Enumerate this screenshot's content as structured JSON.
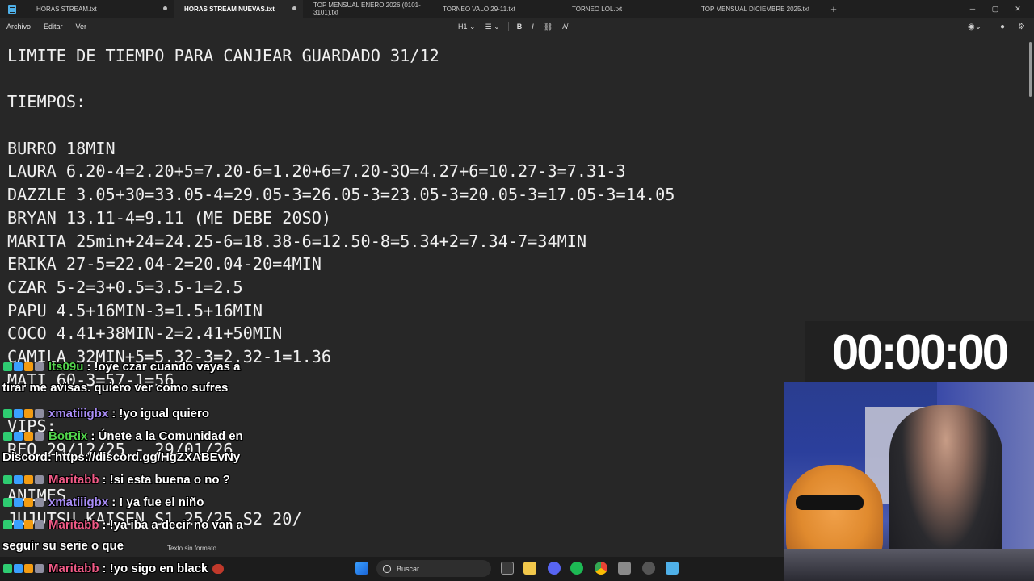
{
  "tabs": [
    {
      "label": "HORAS STREAM.txt",
      "active": false,
      "unsaved": true
    },
    {
      "label": "HORAS STREAM NUEVAS.txt",
      "active": true,
      "unsaved": true
    },
    {
      "label": "TOP MENSUAL ENERO 2026 (0101-3101).txt",
      "active": false,
      "unsaved": false
    },
    {
      "label": "TORNEO VALO 29-11.txt",
      "active": false,
      "unsaved": false
    },
    {
      "label": "TORNEO LOL.txt",
      "active": false,
      "unsaved": false
    },
    {
      "label": "TOP MENSUAL DICIEMBRE 2025.txt",
      "active": false,
      "unsaved": false
    }
  ],
  "tab_add": "+",
  "window_controls": {
    "minimize": "─",
    "maximize": "▢",
    "close": "✕"
  },
  "menu": {
    "file": "Archivo",
    "edit": "Editar",
    "view": "Ver"
  },
  "toolbar": {
    "heading": "H1",
    "bold": "B",
    "italic": "I"
  },
  "editor_lines": [
    "LIMITE DE TIEMPO PARA CANJEAR GUARDADO 31/12",
    "",
    "TIEMPOS:",
    "",
    "BURRO 18MIN",
    "LAURA 6.20-4=2.20+5=7.20-6=1.20+6=7.20-3O=4.27+6=10.27-3=7.31-3",
    "DAZZLE 3.05+30=33.05-4=29.05-3=26.05-3=23.05-3=20.05-3=17.05-3=14.05",
    "BRYAN 13.11-4=9.11 (ME DEBE 20SO)",
    "MARITA 25min+24=24.25-6=18.38-6=12.50-8=5.34+2=7.34-7=34MIN",
    "ERIKA 27-5=22.04-2=20.04-20=4MIN",
    "CZAR 5-2=3+0.5=3.5-1=2.5",
    "PAPU 4.5+16MIN-3=1.5+16MIN",
    "COCO 4.41+38MIN-2=2.41+50MIN",
    "CAMILA 32MIN+5=5.32-3=2.32-1=1.36",
    "MATI 60-3=57-1=56",
    "",
    "VIPS:",
    "REQ 29/12/25 - 29/01/26",
    "",
    "ANIMES",
    "JUJUTSU KAISEN S1 25/25 S2 20/"
  ],
  "status": {
    "format": "Texto sin formato"
  },
  "taskbar": {
    "search_label": "Buscar"
  },
  "timer": {
    "value": "00:00:00"
  },
  "chat": [
    {
      "user": "lts09u",
      "message": ": !oye czar cuando vayas a",
      "continuation": "tirar me avisas. quiero ver como sufres",
      "color": "user-green"
    },
    {
      "user": "xmatiiigbx",
      "message": ": !yo igual quiero",
      "continuation": "",
      "color": "user-purple"
    },
    {
      "user": "BotRix",
      "message": ": Únete a la Comunidad en",
      "continuation": "Discord: https://discord.gg/HgZXABEvNy",
      "color": "user-green"
    },
    {
      "user": "Maritabb",
      "message": ": !si esta buena o no ?",
      "continuation": "",
      "color": "user-pink"
    },
    {
      "user": "xmatiiigbx",
      "message": ": ! ya fue el niño",
      "continuation": "",
      "color": "user-purple"
    },
    {
      "user": "Maritabb",
      "message": ": !ya iba a decir no van a",
      "continuation": "seguir su serie o que",
      "color": "user-pink"
    },
    {
      "user": "Maritabb",
      "message": ": !yo sigo en black",
      "continuation": "",
      "color": "user-pink"
    }
  ],
  "colors": {
    "background": "#272727",
    "tabbar": "#1f1f1f",
    "accent": "#4fb0e8"
  }
}
